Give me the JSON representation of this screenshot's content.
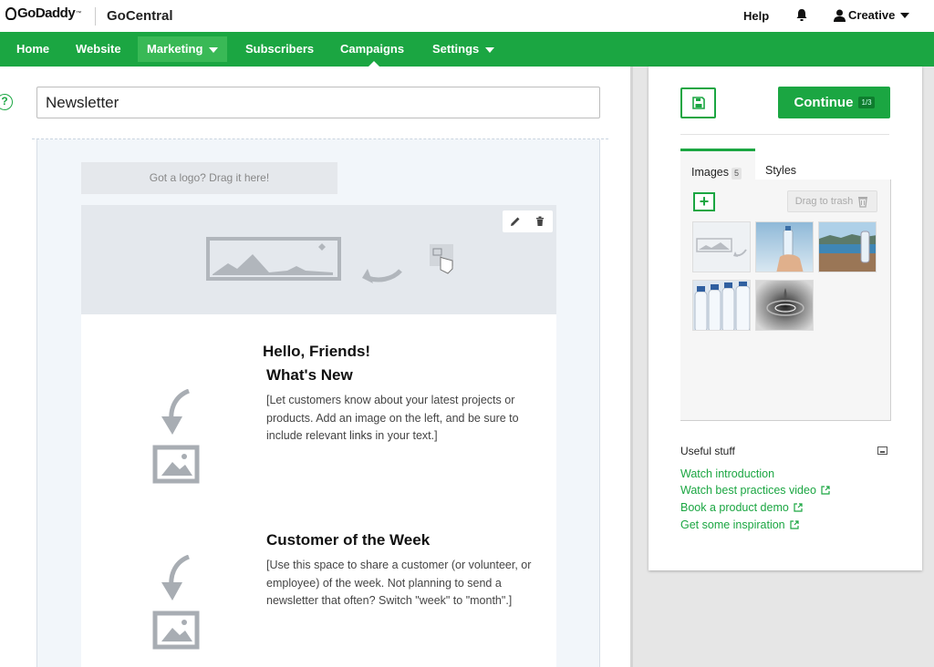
{
  "header": {
    "brand": "GoDaddy",
    "brand_tm": "™",
    "product": "GoCentral",
    "help_label": "Help",
    "account_label": "Creative"
  },
  "nav": {
    "items": [
      {
        "label": "Home"
      },
      {
        "label": "Website"
      },
      {
        "label": "Marketing"
      },
      {
        "label": "Subscribers"
      },
      {
        "label": "Campaigns"
      },
      {
        "label": "Settings"
      }
    ]
  },
  "editor": {
    "help_symbol": "?",
    "title_value": "Newsletter",
    "logo_drop_text": "Got a logo? Drag it here!",
    "greeting": "Hello, Friends!",
    "section1": {
      "title": "What's New",
      "body_before_link": "[Let customers know about your latest projects or products. Add an image on the left, and be sure to include relevant ",
      "link_text": "links",
      "body_after_link": " in your text.]"
    },
    "section2": {
      "title": "Customer of the Week",
      "body": "[Use this space to share a customer (or volunteer, or employee) of the week. Not planning to send a newsletter that often? Switch \"week\" to \"month\".]"
    }
  },
  "panel": {
    "continue_label": "Continue",
    "step_label": "1/3",
    "tabs": {
      "images_label": "Images",
      "images_count": "5",
      "styles_label": "Styles"
    },
    "trash_label": "Drag to trash",
    "add_symbol": "+",
    "useful_title": "Useful stuff",
    "links": [
      {
        "label": "Watch introduction"
      },
      {
        "label": "Watch best practices video"
      },
      {
        "label": "Book a product demo"
      },
      {
        "label": "Get some inspiration"
      }
    ]
  },
  "colors": {
    "brand_green": "#1ba642",
    "nav_active": "#39b956",
    "canvas_bg": "#f2f6fa"
  }
}
